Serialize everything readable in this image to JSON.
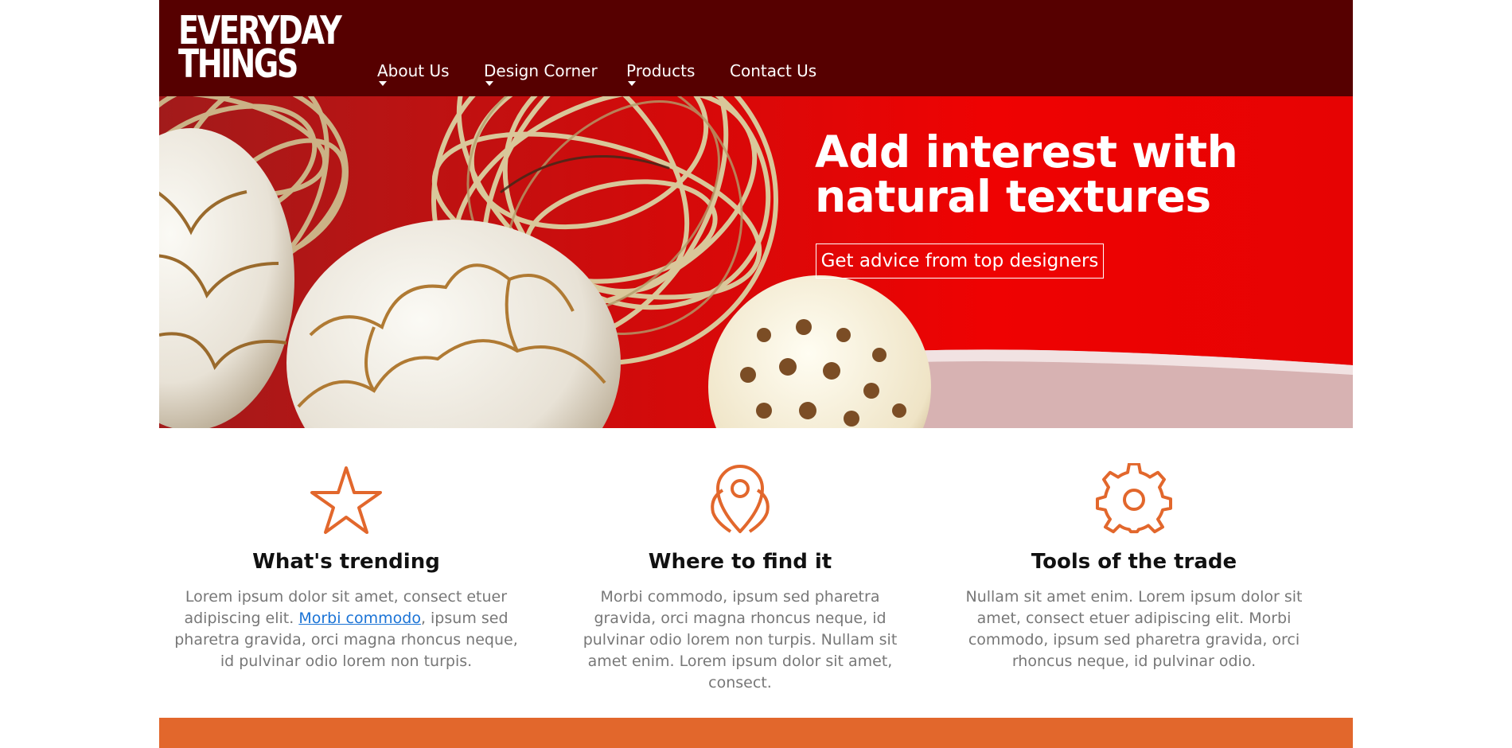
{
  "brand": {
    "line1": "EVERYDAY",
    "line2": "THINGS"
  },
  "nav": {
    "items": [
      {
        "label": "About Us",
        "has_dropdown": true
      },
      {
        "label": "Design Corner",
        "has_dropdown": true
      },
      {
        "label": "Products",
        "has_dropdown": true
      },
      {
        "label": "Contact Us",
        "has_dropdown": false
      }
    ]
  },
  "hero": {
    "title_line1": "Add interest with",
    "title_line2": "natural textures",
    "button_label": "Get advice from top designers"
  },
  "features": [
    {
      "icon": "star-icon",
      "title": "What's trending",
      "text_before_link": "Lorem ipsum dolor sit amet, consect etuer adipiscing elit. ",
      "link_text": "Morbi commodo",
      "text_after_link": ", ipsum sed pharetra gravida, orci magna rhoncus neque, id pulvinar odio lorem non turpis."
    },
    {
      "icon": "location-pin-icon",
      "title": "Where to find it",
      "text": "Morbi commodo, ipsum sed pharetra gravida, orci magna rhoncus neque, id pulvinar odio lorem non turpis. Nullam sit amet enim. Lorem ipsum dolor sit amet, consect."
    },
    {
      "icon": "gear-icon",
      "title": "Tools of the trade",
      "text": "Nullam sit amet enim. Lorem ipsum dolor sit amet, consect etuer adipiscing elit. Morbi commodo, ipsum sed pharetra gravida, orci rhoncus neque, id pulvinar odio."
    }
  ],
  "colors": {
    "header_bg": "#560000",
    "hero_red": "#ef0202",
    "accent_orange": "#e2672c",
    "link_blue": "#1a73d6"
  }
}
